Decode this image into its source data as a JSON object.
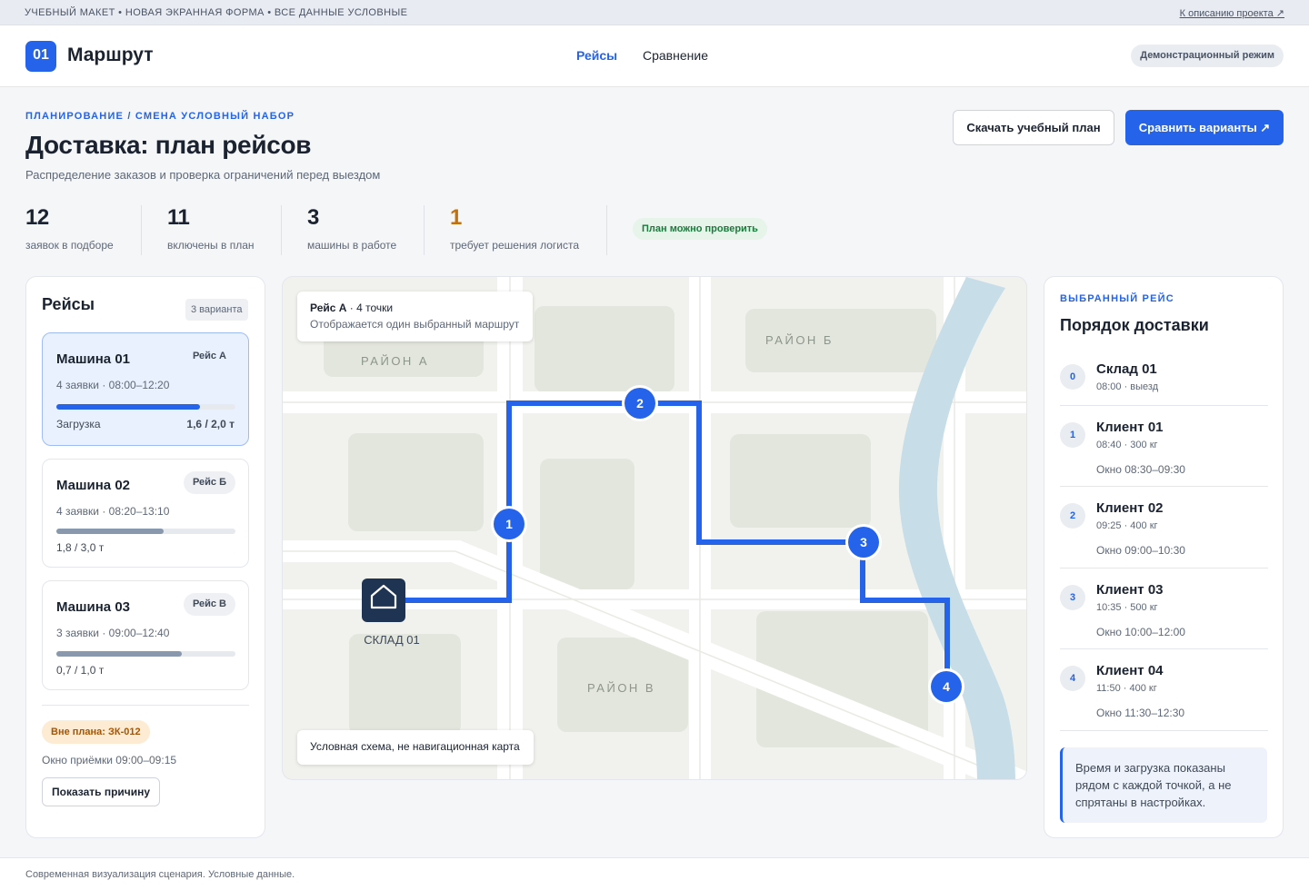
{
  "top_strip": {
    "text": "УЧЕБНЫЙ МАКЕТ • НОВАЯ ЭКРАННАЯ ФОРМА • ВСЕ ДАННЫЕ УСЛОВНЫЕ",
    "link": "К описанию проекта ↗"
  },
  "header": {
    "logo": "01",
    "title": "Маршрут",
    "nav": [
      "Рейсы",
      "Сравнение"
    ],
    "active_nav": "Рейсы",
    "mode_badge": "Демонстрационный режим"
  },
  "page": {
    "breadcrumb": "ПЛАНИРОВАНИЕ / СМЕНА УСЛОВНЫЙ НАБОР",
    "title": "Доставка: план рейсов",
    "subtitle": "Распределение заказов и проверка ограничений перед выездом",
    "download_label": "Скачать учебный план",
    "compare_label": "Сравнить варианты ↗"
  },
  "stats": [
    {
      "value": "12",
      "label": "заявок в подборе"
    },
    {
      "value": "11",
      "label": "включены в план"
    },
    {
      "value": "3",
      "label": "машины в работе"
    },
    {
      "value": "1",
      "label": "требует решения логиста"
    }
  ],
  "plan_status": "План можно проверить",
  "trips_panel": {
    "title": "Рейсы",
    "variants": "3 варианта",
    "cars": [
      {
        "name": "Машина 01",
        "tag": "Рейс А",
        "meta": "4 заявки · 08:00–12:20",
        "load_label": "Загрузка",
        "load": "1,6 / 2,0 т",
        "fill": 0.8
      },
      {
        "name": "Машина 02",
        "tag": "Рейс Б",
        "meta": "4 заявки · 08:20–13:10",
        "load": "1,8 / 3,0 т",
        "fill": 0.6
      },
      {
        "name": "Машина 03",
        "tag": "Рейс В",
        "meta": "3 заявки · 09:00–12:40",
        "load": "0,7 / 1,0 т",
        "fill": 0.7
      }
    ],
    "unplanned": "Вне плана: ЗК-012",
    "unplanned_window": "Окно приёмки 09:00–09:15",
    "reason_button": "Показать причину"
  },
  "map": {
    "card_title": "Рейс А",
    "card_points": " · 4 точки",
    "card_sub": "Отображается один выбранный маршрут",
    "district_a": "РАЙОН А",
    "district_b": "РАЙОН Б",
    "district_c": "РАЙОН В",
    "depot_label": "СКЛАД 01",
    "markers": [
      "1",
      "2",
      "3",
      "4"
    ],
    "disclaimer": "Условная схема, не навигационная карта",
    "route_color": "#2563eb"
  },
  "route_panel": {
    "kicker": "ВЫБРАННЫЙ РЕЙС",
    "title": "Порядок доставки",
    "stops": [
      {
        "num": "0",
        "name": "Склад 01",
        "meta": "08:00 · выезд",
        "window": ""
      },
      {
        "num": "1",
        "name": "Клиент 01",
        "meta": "08:40 · 300 кг",
        "window": "Окно 08:30–09:30"
      },
      {
        "num": "2",
        "name": "Клиент 02",
        "meta": "09:25 · 400 кг",
        "window": "Окно 09:00–10:30"
      },
      {
        "num": "3",
        "name": "Клиент 03",
        "meta": "10:35 · 500 кг",
        "window": "Окно 10:00–12:00"
      },
      {
        "num": "4",
        "name": "Клиент 04",
        "meta": "11:50 · 400 кг",
        "window": "Окно 11:30–12:30"
      }
    ],
    "note": "Время и загрузка показаны рядом с каждой точкой, а не спрятаны в настройках."
  },
  "footer": "Современная визуализация сценария. Условные данные.",
  "colors": {
    "accent": "#2563eb",
    "warning": "#c2710c",
    "success": "#1d7a3d"
  }
}
